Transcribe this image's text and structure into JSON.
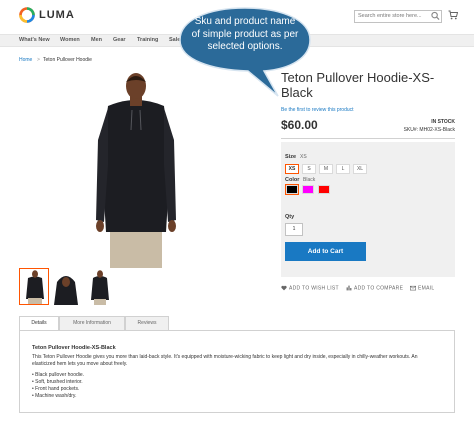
{
  "header": {
    "logo_text": "LUMA",
    "search_placeholder": "Search entire store here..."
  },
  "nav": {
    "items": [
      "What's New",
      "Women",
      "Men",
      "Gear",
      "Training",
      "Sale"
    ]
  },
  "breadcrumb": {
    "home": "Home",
    "separator": ">",
    "current": "Teton Pullover Hoodie"
  },
  "product": {
    "title": "Teton Pullover Hoodie-XS-Black",
    "review_link": "Be the first to review this product",
    "price": "$60.00",
    "stock": "IN STOCK",
    "sku_label": "SKU#:",
    "sku_value": "MH02-XS-Black",
    "size_label": "Size",
    "size_selected": "XS",
    "sizes": [
      "XS",
      "S",
      "M",
      "L",
      "XL"
    ],
    "color_label": "Color",
    "color_selected": "Black",
    "colors": [
      "#000000",
      "#ff00ff",
      "#ff0000"
    ],
    "qty_label": "Qty",
    "qty_value": "1",
    "add_to_cart": "Add to Cart",
    "wishlist": "ADD TO WISH LIST",
    "compare": "ADD TO COMPARE",
    "email": "EMAIL"
  },
  "tabs": {
    "items": [
      "Details",
      "More Information",
      "Reviews"
    ]
  },
  "details": {
    "title": "Teton Pullover Hoodie-XS-Black",
    "text": "This Teton Pullover Hoodie gives you more than laid-back style. It's equipped with moisture-wicking fabric to keep light and dry inside, especially in chilly-weather workouts. An elasticized hem lets you move about freely.",
    "bullets": [
      "• Black pullover hoodie.",
      "• Soft, brushed interior.",
      "• Front hand pockets.",
      "• Machine wash/dry."
    ]
  },
  "callout": {
    "text": "Sku and product name of simple product as per selected options."
  },
  "colors": {
    "accent": "#1979c3",
    "selected": "#ff5501",
    "callout": "#2b6a99"
  }
}
